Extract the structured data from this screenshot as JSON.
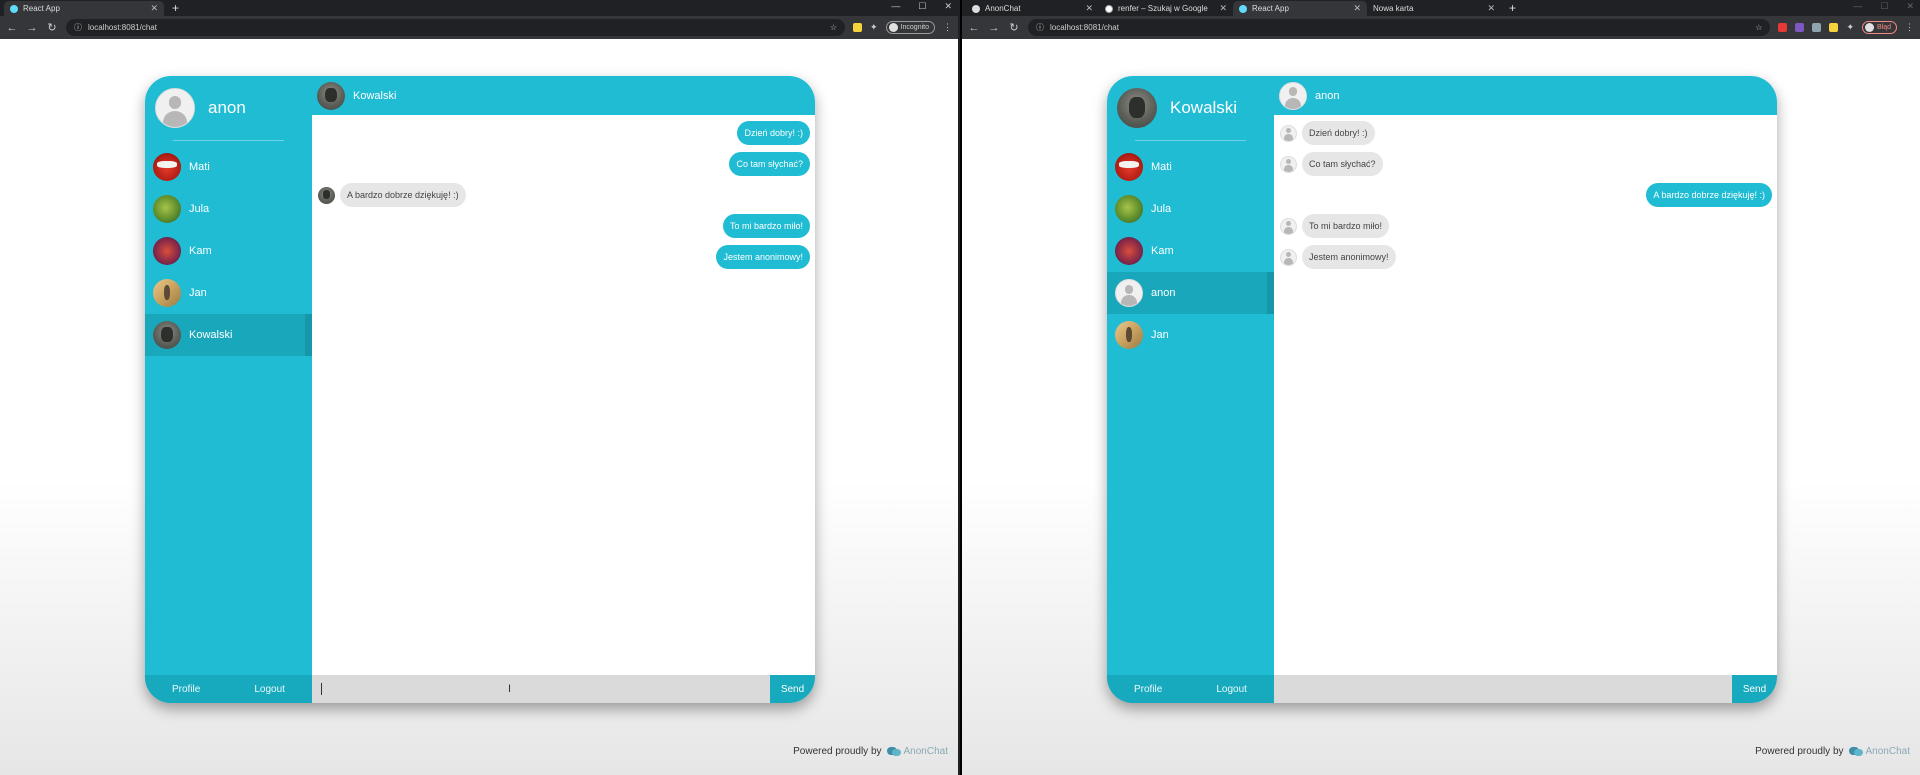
{
  "left": {
    "tabs": [
      {
        "label": "React App",
        "active": true,
        "favicon": "react-icon"
      }
    ],
    "url": "localhost:8081/chat",
    "profile_label": "Incognito",
    "current_user": "anon",
    "contacts": [
      {
        "name": "Mati",
        "avatar": "mati"
      },
      {
        "name": "Jula",
        "avatar": "jula"
      },
      {
        "name": "Kam",
        "avatar": "kam"
      },
      {
        "name": "Jan",
        "avatar": "jan"
      },
      {
        "name": "Kowalski",
        "avatar": "kowalski",
        "active": true
      }
    ],
    "chat_partner": "Kowalski",
    "messages": [
      {
        "dir": "out",
        "text": "Dzień dobry! :)"
      },
      {
        "dir": "out",
        "text": "Co tam słychać?"
      },
      {
        "dir": "in",
        "text": "A bardzo dobrze dziękuję! :)"
      },
      {
        "dir": "out",
        "text": "To mi bardzo miło!"
      },
      {
        "dir": "out",
        "text": "Jestem anonimowy!"
      }
    ]
  },
  "right": {
    "tabs": [
      {
        "label": "AnonChat",
        "active": false,
        "favicon": "github-icon"
      },
      {
        "label": "renfer – Szukaj w Google",
        "active": false,
        "favicon": "google-icon"
      },
      {
        "label": "React App",
        "active": true,
        "favicon": "react-icon"
      },
      {
        "label": "Nowa karta",
        "active": false,
        "favicon": ""
      }
    ],
    "url": "localhost:8081/chat",
    "profile_label": "Błąd",
    "current_user": "Kowalski",
    "contacts": [
      {
        "name": "Mati",
        "avatar": "mati"
      },
      {
        "name": "Jula",
        "avatar": "jula"
      },
      {
        "name": "Kam",
        "avatar": "kam"
      },
      {
        "name": "anon",
        "avatar": "anon",
        "active": true
      },
      {
        "name": "Jan",
        "avatar": "jan"
      }
    ],
    "chat_partner": "anon",
    "messages": [
      {
        "dir": "in",
        "text": "Dzień dobry! :)"
      },
      {
        "dir": "in",
        "text": "Co tam słychać?"
      },
      {
        "dir": "out",
        "text": "A bardzo dobrze dziękuję! :)"
      },
      {
        "dir": "in",
        "text": "To mi bardzo miło!"
      },
      {
        "dir": "in",
        "text": "Jestem anonimowy!"
      }
    ]
  },
  "common": {
    "profile_button": "Profile",
    "logout_button": "Logout",
    "send_button": "Send",
    "powered_by": "Powered proudly by",
    "brand": "AnonChat",
    "colors": {
      "accent": "#1fbcd3",
      "accent_dark": "#17a9bd",
      "bubble_in": "#e6e6e6"
    }
  }
}
